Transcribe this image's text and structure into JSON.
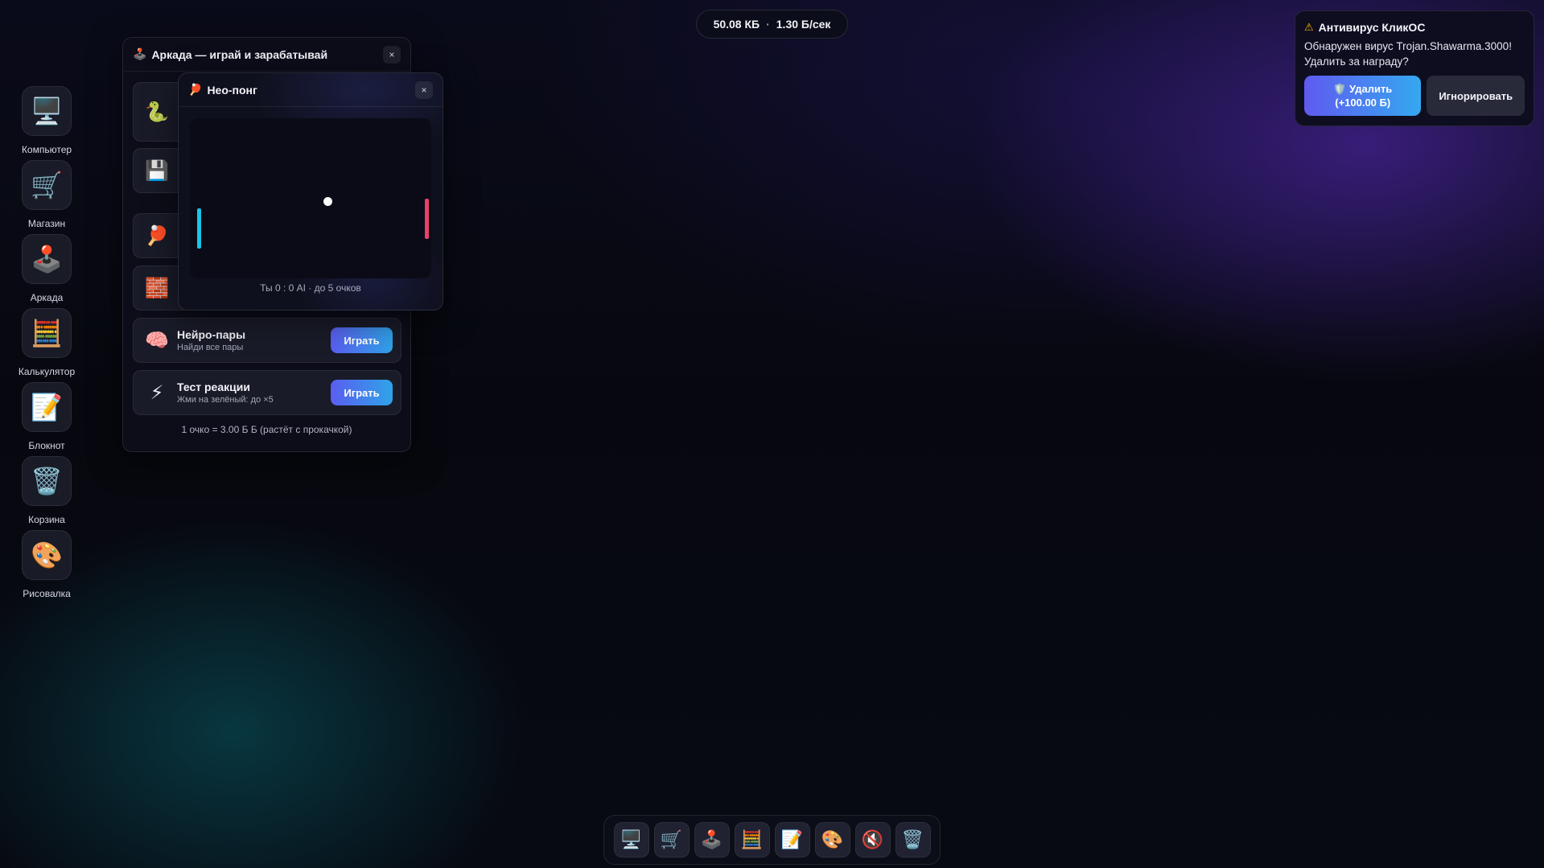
{
  "stats": {
    "balance": "50.08 КБ",
    "separator": "·",
    "rate": "1.30 Б/сек"
  },
  "desktop": {
    "items": [
      {
        "label": "Компьютер",
        "icon": "computer-icon",
        "glyph": "🖥️"
      },
      {
        "label": "Магазин",
        "icon": "shopping-cart-icon",
        "glyph": "🛒"
      },
      {
        "label": "Аркада",
        "icon": "joystick-icon",
        "glyph": "🕹️"
      },
      {
        "label": "Калькулятор",
        "icon": "abacus-icon",
        "glyph": "🧮"
      },
      {
        "label": "Блокнот",
        "icon": "notepad-icon",
        "glyph": "📝"
      },
      {
        "label": "Корзина",
        "icon": "trash-icon",
        "glyph": "🗑️"
      },
      {
        "label": "Рисовалка",
        "icon": "palette-icon",
        "glyph": "🎨"
      }
    ]
  },
  "arcade": {
    "title_icon": "🕹️",
    "title": "Аркада — играй и зарабатывай",
    "close": "×",
    "hidden_cards": [
      {
        "icon": "snake-icon",
        "glyph": "🐍"
      },
      {
        "icon": "floppy-disk-icon",
        "glyph": "💾"
      },
      {
        "icon": "ping-pong-icon",
        "glyph": "🏓"
      },
      {
        "icon": "bricks-icon",
        "glyph": "🧱"
      }
    ],
    "games": [
      {
        "name": "Нейро-пары",
        "desc": "Найди все пары",
        "button": "Играть",
        "icon": "brain-icon",
        "glyph": "🧠"
      },
      {
        "name": "Тест реакции",
        "desc": "Жми на зелёный: до ×5",
        "button": "Играть",
        "icon": "lightning-icon",
        "glyph": "⚡"
      }
    ],
    "footer": "1 очко = 3.00 Б Б (растёт с прокачкой)"
  },
  "pong": {
    "title_icon": "🏓",
    "title": "Нео-понг",
    "close": "×",
    "score": "Ты 0 : 0 AI · до 5 очков",
    "colors": {
      "left_paddle": "#19c4e6",
      "right_paddle": "#ee3f6b",
      "ball": "#ffffff"
    }
  },
  "antivirus": {
    "icon": "warning-icon",
    "warn_glyph": "⚠",
    "title": "Антивирус КликОС",
    "message": "Обнаружен вирус Trojan.Shawarma.3000! Удалить за награду?",
    "delete_line1": "🛡️ Удалить",
    "delete_line2": "(+100.00 Б)",
    "ignore": "Игнорировать"
  },
  "taskbar": {
    "items": [
      {
        "icon": "computer-icon",
        "glyph": "🖥️"
      },
      {
        "icon": "shopping-cart-icon",
        "glyph": "🛒"
      },
      {
        "icon": "joystick-icon",
        "glyph": "🕹️"
      },
      {
        "icon": "abacus-icon",
        "glyph": "🧮"
      },
      {
        "icon": "notepad-icon",
        "glyph": "📝"
      },
      {
        "icon": "palette-icon",
        "glyph": "🎨"
      },
      {
        "icon": "mute-icon",
        "glyph": "🔇"
      },
      {
        "icon": "trash-icon",
        "glyph": "🗑️"
      }
    ]
  },
  "theme": {
    "accent_gradient_start": "#5a5ef0",
    "accent_gradient_end": "#2fa3e8",
    "warning": "#f5b400"
  }
}
